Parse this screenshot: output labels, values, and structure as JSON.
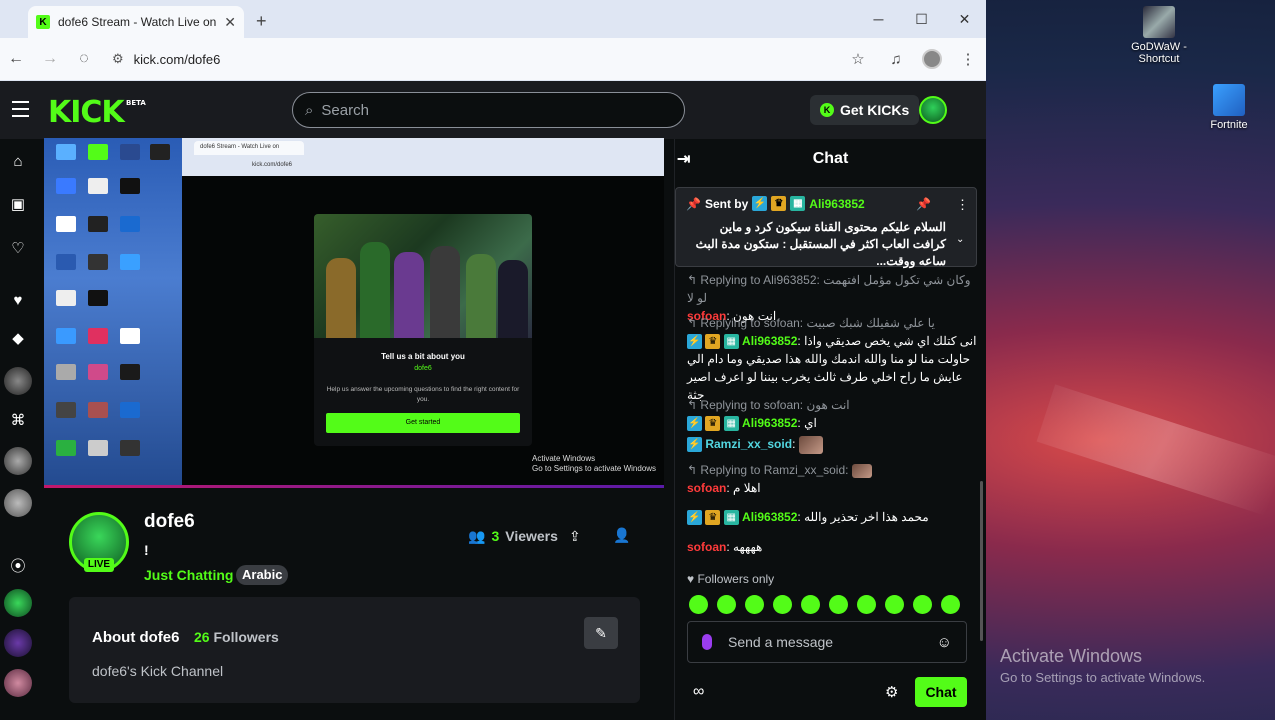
{
  "desktop": {
    "icons": [
      {
        "label": "GoDWaW - Shortcut"
      },
      {
        "label": "Fortnite"
      }
    ],
    "activate": {
      "title": "Activate Windows",
      "subtitle": "Go to Settings to activate Windows."
    }
  },
  "browser": {
    "tab_title": "dofe6 Stream - Watch Live on K",
    "url": "kick.com/dofe6",
    "window_controls": {
      "minimize": "─",
      "maximize": "☐",
      "close": "✕"
    }
  },
  "kick": {
    "logo": "KICK",
    "logo_badge": "BETA",
    "search_placeholder": "Search",
    "get_kicks_label": "Get KICKs",
    "channel": {
      "name": "dofe6",
      "title": "!",
      "live_label": "LIVE",
      "category": "Just Chatting",
      "language": "Arabic",
      "viewers_count": "3",
      "viewers_label": "Viewers"
    },
    "about": {
      "title": "About dofe6",
      "followers_count": "26",
      "followers_label": "Followers",
      "description": "dofe6's Kick Channel"
    },
    "video": {
      "modal_heading": "Tell us a bit about you",
      "modal_name": "dofe6",
      "modal_desc": "Help us answer the upcoming questions to find the right content for you.",
      "modal_button": "Get started",
      "overlay_activate_1": "Activate Windows",
      "overlay_activate_2": "Go to Settings to activate Windows",
      "inner_tab": "dofe6 Stream - Watch Live on",
      "inner_url": "kick.com/dofe6"
    }
  },
  "chat": {
    "title": "Chat",
    "pinned": {
      "sent_by_label": "Sent by",
      "user": "Ali963852",
      "message": "السلام عليكم محتوى القناة سيكون كرد و ماين كرافت العاب اكثر في المستقبل : ستكون مدة البث ساعه ووقت..."
    },
    "messages": [
      {
        "reply_to": "Replying to Ali963852:",
        "reply_text": "وكان شي تكول مؤمل افتهمت لو لا",
        "user": "sofoan",
        "user_color": "red",
        "text": "انت هون"
      },
      {
        "reply_to": "Replying to sofoan:",
        "reply_text": "يا علي شفيلك شبك صبيت",
        "user": "Ali963852",
        "user_color": "green",
        "text": "انى كتلك اي شي يخص صديقي واذا حاولت منا لو منا والله اندمك والله هذا صديقي وما دام الي عايش ما راح اخلي طرف ثالث يخرب بيننا لو اعرف اصير جثة"
      },
      {
        "reply_to": "Replying to sofoan:",
        "reply_text": "انت هون",
        "user": "Ali963852",
        "user_color": "green",
        "text": "اي"
      },
      {
        "reply_to": "",
        "reply_text": "",
        "user": "Ramzi_xx_soid",
        "user_color": "cyan",
        "text": ""
      },
      {
        "reply_to": "Replying to Ramzi_xx_soid:",
        "reply_text": "",
        "user": "sofoan",
        "user_color": "red",
        "text": "اهلا م"
      },
      {
        "reply_to": "",
        "reply_text": "",
        "user": "Ali963852",
        "user_color": "green",
        "text": "محمد هذا اخر تحذير والله"
      },
      {
        "reply_to": "",
        "reply_text": "",
        "user": "sofoan",
        "user_color": "red",
        "text": "ههههه"
      }
    ],
    "followers_only": "Followers only",
    "input_placeholder": "Send a message",
    "send_label": "Chat"
  }
}
